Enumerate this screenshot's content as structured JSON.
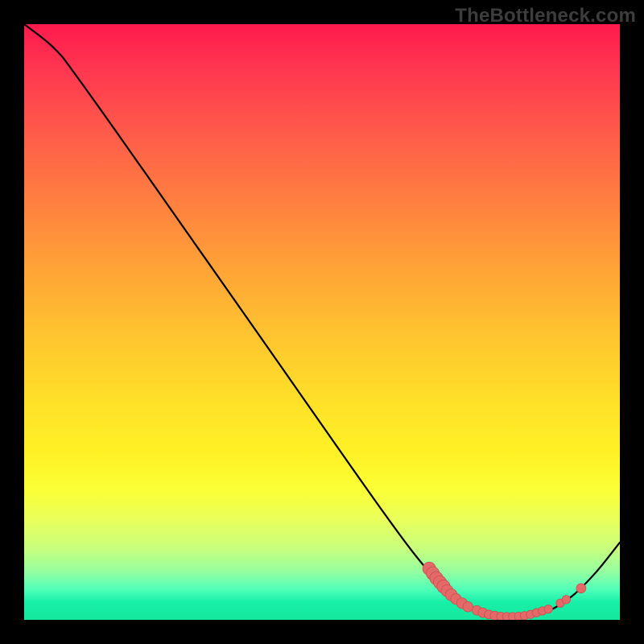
{
  "watermark": "TheBottleneck.com",
  "colors": {
    "frame": "#000000",
    "watermark": "#3d3d3d",
    "dot_fill": "#e46a6a",
    "dot_stroke": "#c94f4f",
    "curve_stroke": "#000000"
  },
  "chart_data": {
    "type": "line",
    "title": "",
    "xlabel": "",
    "ylabel": "",
    "xlim": [
      0,
      100
    ],
    "ylim": [
      0,
      100
    ],
    "grid": false,
    "legend": false,
    "background_gradient": true,
    "curve": [
      {
        "x": 0,
        "y": 100
      },
      {
        "x": 5,
        "y": 96
      },
      {
        "x": 9,
        "y": 91
      },
      {
        "x": 20,
        "y": 75.5
      },
      {
        "x": 40,
        "y": 47
      },
      {
        "x": 60,
        "y": 18.5
      },
      {
        "x": 68,
        "y": 8
      },
      {
        "x": 72,
        "y": 4
      },
      {
        "x": 76,
        "y": 1.5
      },
      {
        "x": 80,
        "y": 0.6
      },
      {
        "x": 84,
        "y": 0.6
      },
      {
        "x": 88,
        "y": 1.5
      },
      {
        "x": 92,
        "y": 4
      },
      {
        "x": 96,
        "y": 8
      },
      {
        "x": 100,
        "y": 13
      }
    ],
    "dots": [
      {
        "x": 68.0,
        "y": 8.6,
        "r": 1.1
      },
      {
        "x": 68.6,
        "y": 7.8,
        "r": 1.1
      },
      {
        "x": 69.2,
        "y": 7.0,
        "r": 1.1
      },
      {
        "x": 69.8,
        "y": 6.3,
        "r": 1.1
      },
      {
        "x": 70.4,
        "y": 5.6,
        "r": 1.1
      },
      {
        "x": 71.0,
        "y": 4.9,
        "r": 1.0
      },
      {
        "x": 71.7,
        "y": 4.2,
        "r": 1.0
      },
      {
        "x": 72.5,
        "y": 3.5,
        "r": 0.9
      },
      {
        "x": 73.5,
        "y": 2.8,
        "r": 0.9
      },
      {
        "x": 74.5,
        "y": 2.2,
        "r": 0.85
      },
      {
        "x": 76.0,
        "y": 1.6,
        "r": 0.8
      },
      {
        "x": 77.0,
        "y": 1.2,
        "r": 0.8
      },
      {
        "x": 78.0,
        "y": 0.9,
        "r": 0.75
      },
      {
        "x": 79.0,
        "y": 0.7,
        "r": 0.75
      },
      {
        "x": 80.0,
        "y": 0.6,
        "r": 0.7
      },
      {
        "x": 81.0,
        "y": 0.55,
        "r": 0.7
      },
      {
        "x": 82.0,
        "y": 0.55,
        "r": 0.7
      },
      {
        "x": 83.0,
        "y": 0.6,
        "r": 0.7
      },
      {
        "x": 84.0,
        "y": 0.7,
        "r": 0.7
      },
      {
        "x": 85.0,
        "y": 0.9,
        "r": 0.7
      },
      {
        "x": 86.0,
        "y": 1.2,
        "r": 0.7
      },
      {
        "x": 87.0,
        "y": 1.5,
        "r": 0.7
      },
      {
        "x": 88.0,
        "y": 1.8,
        "r": 0.7
      },
      {
        "x": 90.0,
        "y": 2.8,
        "r": 0.7
      },
      {
        "x": 91.0,
        "y": 3.4,
        "r": 0.7
      },
      {
        "x": 93.5,
        "y": 5.3,
        "r": 0.8
      }
    ]
  }
}
